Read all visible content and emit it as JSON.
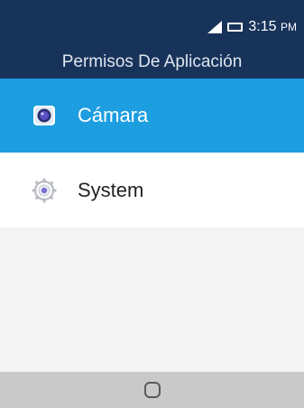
{
  "status_bar": {
    "time": "3:15",
    "ampm": "PM",
    "icons": [
      "signal-icon",
      "battery-icon"
    ]
  },
  "header": {
    "title": "Permisos De Aplicación"
  },
  "list": {
    "items": [
      {
        "label": "Cámara",
        "icon": "camera-icon",
        "selected": true
      },
      {
        "label": "System",
        "icon": "gear-icon",
        "selected": false
      }
    ]
  },
  "nav": {
    "home_icon": "home-key-icon"
  },
  "colors": {
    "header_bg": "#18335a",
    "selected_bg": "#1c9ee0",
    "nav_bg": "#c9c9c9"
  }
}
